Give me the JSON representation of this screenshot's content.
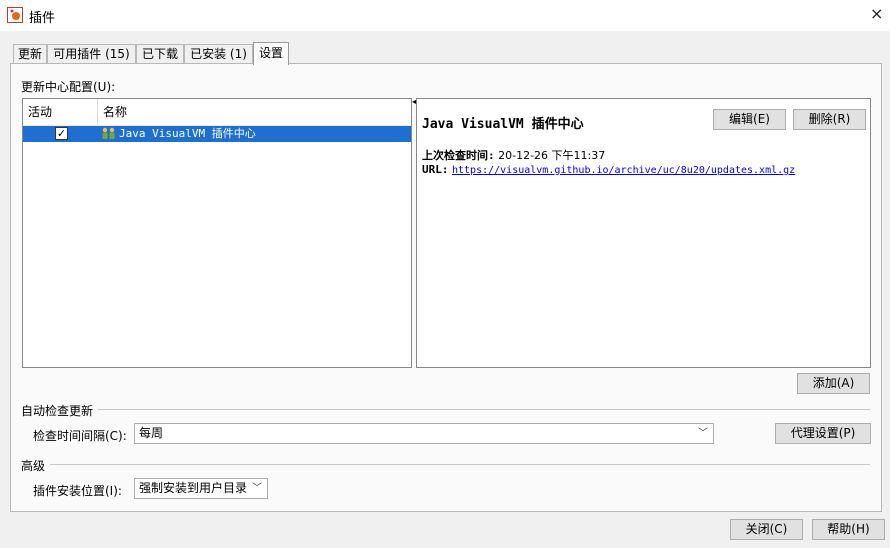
{
  "window": {
    "title": "插件",
    "close_icon": "×"
  },
  "tabs": [
    {
      "label": "更新"
    },
    {
      "label": "可用插件 (15)"
    },
    {
      "label": "已下载"
    },
    {
      "label": "已安装 (1)"
    },
    {
      "label": "设置",
      "active": true
    }
  ],
  "settings": {
    "update_center_label": "更新中心配置(U):",
    "table": {
      "columns": [
        "活动",
        "名称"
      ],
      "rows": [
        {
          "active": true,
          "checkbox_mark": "✓",
          "name": "Java VisualVM 插件中心",
          "selected": true
        }
      ]
    },
    "details": {
      "title": "Java VisualVM 插件中心",
      "edit_button": "编辑(E)",
      "delete_button": "删除(R)",
      "last_check_label": "上次检查时间:",
      "last_check_value": "20-12-26 下午11:37",
      "url_label": "URL:",
      "url_value": "https://visualvm.github.io/archive/uc/8u20/updates.xml.gz"
    },
    "add_button": "添加(A)",
    "auto_check": {
      "section_title": "自动检查更新",
      "interval_label": "检查时间间隔(C):",
      "interval_value": "每周",
      "proxy_button": "代理设置(P)"
    },
    "advanced": {
      "section_title": "高级",
      "install_location_label": "插件安装位置(I):",
      "install_location_value": "强制安装到用户目录"
    }
  },
  "footer": {
    "close_button": "关闭(C)",
    "help_button": "帮助(H)"
  },
  "colors": {
    "selection": "#1f6fd1",
    "link": "#0000ee"
  }
}
